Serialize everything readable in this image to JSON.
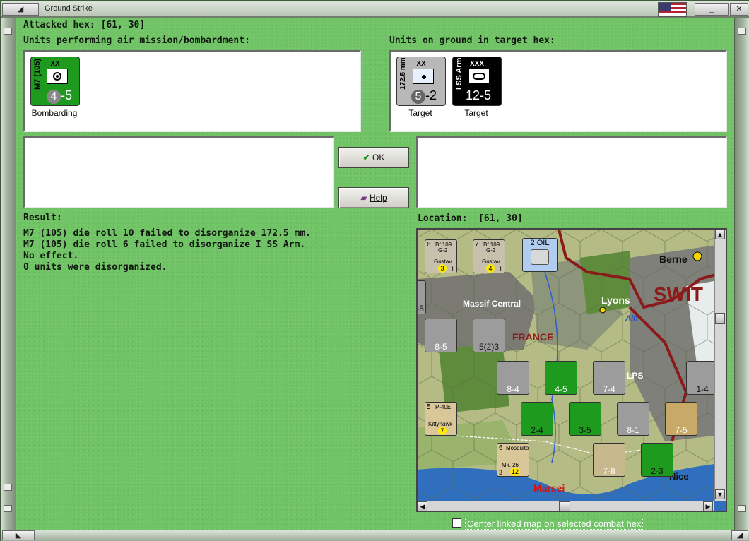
{
  "window": {
    "title": "Ground Strike"
  },
  "attacked_hex": {
    "label": "Attacked hex:",
    "value": "[61, 30]"
  },
  "air_units": {
    "header": "Units performing air mission/bombardment:",
    "units": [
      {
        "size": "XX",
        "name": "M7 (105)",
        "strength_a": "4",
        "strength_b": "-5",
        "status": "Bombarding",
        "color": "#1e9b1e"
      }
    ]
  },
  "ground_units": {
    "header": "Units on ground in target hex:",
    "units": [
      {
        "size": "XX",
        "name": "172.5 mm",
        "strength_a": "5",
        "strength_b": "-2",
        "status": "Target",
        "color": "#b8b8b8"
      },
      {
        "size": "XXX",
        "name": "I SS Arm",
        "strength_a": "12-5",
        "strength_b": "",
        "status": "Target",
        "color": "#000000"
      }
    ]
  },
  "buttons": {
    "ok": "OK",
    "help": "Help"
  },
  "result": {
    "label": "Result:",
    "lines": [
      "M7 (105) die roll 10 failed to disorganize 172.5 mm.",
      "M7 (105) die roll 6 failed to disorganize I SS Arm.",
      "No effect.",
      "0 units were disorganized."
    ]
  },
  "location": {
    "label": "Location:",
    "value": "[61, 30]"
  },
  "map": {
    "labels": {
      "massif": "Massif Central",
      "france": "FRANCE",
      "lyons": "Lyons",
      "berne": "Berne",
      "switz": "SWIT",
      "ain": "Ain",
      "lps": "LPS",
      "nice": "Nice",
      "marseille": "Marsei"
    },
    "oil": "2 OIL",
    "counters": [
      {
        "top": "Bf 109",
        "mid": "G-2",
        "sub": "Gustav",
        "a": "3",
        "b": "1",
        "n": "6"
      },
      {
        "top": "Bf 109",
        "mid": "G-2",
        "sub": "Gustav",
        "a": "4",
        "b": "1",
        "n": "7"
      },
      {
        "str": "8-5"
      },
      {
        "str": "5(2)3",
        "tag": "2"
      },
      {
        "str": "8-4"
      },
      {
        "str": "4-5",
        "tag": "3"
      },
      {
        "str": "7-4"
      },
      {
        "str": "1-4",
        "tag": "3"
      },
      {
        "top": "P-40E",
        "sub": "Kittyhawk",
        "a": "7",
        "n": "5",
        "tag": "4"
      },
      {
        "str": "2-4",
        "tag": "3"
      },
      {
        "str": "3-5"
      },
      {
        "str": "8-1"
      },
      {
        "str": "7-5"
      },
      {
        "top": "Mosquito",
        "sub": "Mk. 26",
        "a": "12",
        "b": "3",
        "n": "6",
        "tag": "3"
      },
      {
        "str": "7-8",
        "tag": "2"
      },
      {
        "str": "2-3",
        "tag": "2"
      },
      {
        "str": "-5"
      }
    ]
  },
  "center_checkbox": {
    "label": "Center linked map on selected combat hex",
    "checked": false
  }
}
